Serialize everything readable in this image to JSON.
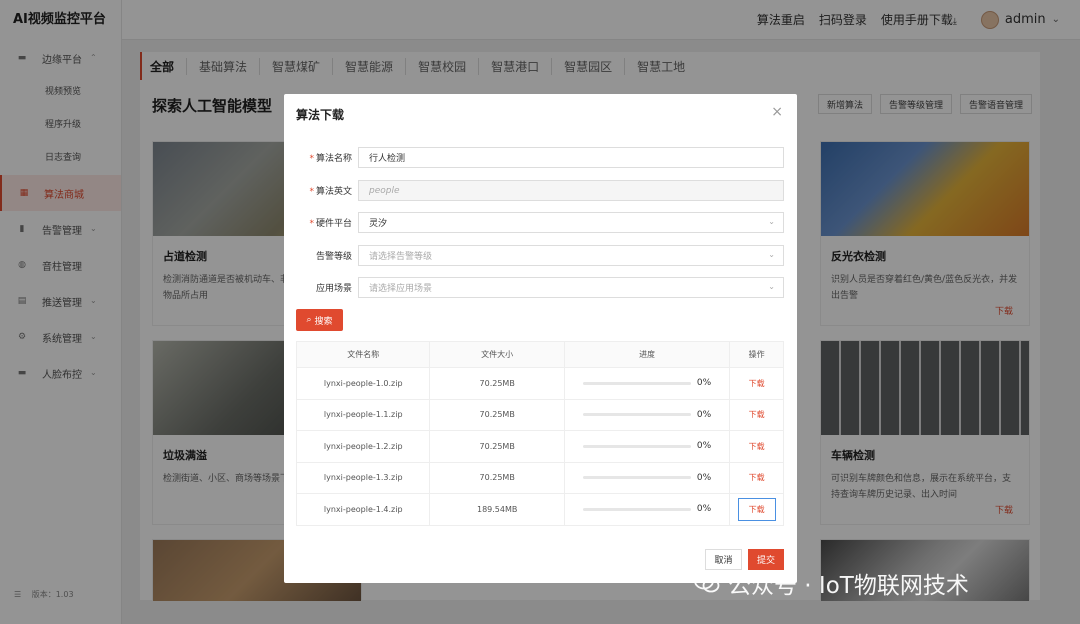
{
  "app": {
    "title": "AI视频监控平台",
    "version": "版本：1.03"
  },
  "sidebar": {
    "items": [
      {
        "label": "边缘平台",
        "icon": "box-icon",
        "chevron": "⌃"
      },
      {
        "label": "视频预览"
      },
      {
        "label": "程序升级"
      },
      {
        "label": "日志查询"
      },
      {
        "label": "算法商城",
        "icon": "grid-icon"
      },
      {
        "label": "告警管理",
        "icon": "bar-chart-icon",
        "chevron": "⌄"
      },
      {
        "label": "音柱管理",
        "icon": "mic-icon"
      },
      {
        "label": "推送管理",
        "icon": "message-icon",
        "chevron": "⌄"
      },
      {
        "label": "系统管理",
        "icon": "gear-icon",
        "chevron": "⌄"
      },
      {
        "label": "人脸布控",
        "icon": "box-icon",
        "chevron": "⌄"
      }
    ]
  },
  "header": {
    "restart": "算法重启",
    "scan_login": "扫码登录",
    "manual": "使用手册下载",
    "manual_icon": "⤓",
    "user": "admin",
    "user_chevron": "⌄"
  },
  "tabs": [
    "全部",
    "基础算法",
    "智慧煤矿",
    "智慧能源",
    "智慧校园",
    "智慧港口",
    "智慧园区",
    "智慧工地"
  ],
  "page": {
    "heading": "探索人工智能模型",
    "toolbar": [
      "新增算法",
      "告警等级管理",
      "告警语音管理"
    ]
  },
  "cards": [
    {
      "title": "占道检测",
      "desc": "检测消防通道是否被机动车、非机动车或非法物品所占用",
      "download": ""
    },
    {
      "title": "反光衣检测",
      "desc": "识别人员是否穿着红色/黄色/蓝色反光衣，并发出告警",
      "download": "下载"
    },
    {
      "title": "垃圾满溢",
      "desc": "检测街道、小区、商场等场景下垃圾满溢",
      "download": ""
    },
    {
      "title": "车辆检测",
      "desc": "可识别车牌颜色和信息，展示在系统平台，支持查询车牌历史记录、出入时间",
      "download": "下载"
    }
  ],
  "modal": {
    "title": "算法下载",
    "close": "×",
    "fields": {
      "name_label": "算法名称",
      "name_value": "行人检测",
      "en_label": "算法英文",
      "en_value": "people",
      "hw_label": "硬件平台",
      "hw_value": "灵汐",
      "level_label": "告警等级",
      "level_placeholder": "请选择告警等级",
      "scene_label": "应用场景",
      "scene_placeholder": "请选择应用场景"
    },
    "search_button": "搜索",
    "table": {
      "headers": [
        "文件名称",
        "文件大小",
        "进度",
        "操作"
      ],
      "rows": [
        {
          "name": "lynxi-people-1.0.zip",
          "size": "70.25MB",
          "progress": 0,
          "progress_text": "0%",
          "action": "下载"
        },
        {
          "name": "lynxi-people-1.1.zip",
          "size": "70.25MB",
          "progress": 0,
          "progress_text": "0%",
          "action": "下载"
        },
        {
          "name": "lynxi-people-1.2.zip",
          "size": "70.25MB",
          "progress": 0,
          "progress_text": "0%",
          "action": "下载"
        },
        {
          "name": "lynxi-people-1.3.zip",
          "size": "70.25MB",
          "progress": 0,
          "progress_text": "0%",
          "action": "下载"
        },
        {
          "name": "lynxi-people-1.4.zip",
          "size": "189.54MB",
          "progress": 0,
          "progress_text": "0%",
          "action": "下载"
        }
      ]
    },
    "cancel": "取消",
    "submit": "提交"
  },
  "watermark": "公众号 · IoT物联网技术",
  "colors": {
    "accent": "#e04a2f"
  }
}
